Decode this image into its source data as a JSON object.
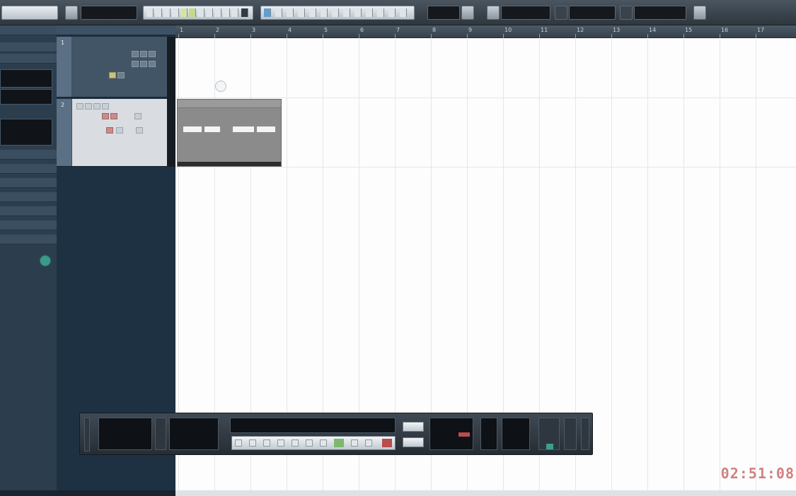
{
  "toolbar": {
    "buttons": [
      {
        "id": "project",
        "label": ""
      },
      {
        "id": "mode",
        "label": ""
      },
      {
        "id": "tools",
        "label": ""
      },
      {
        "id": "snap",
        "label": ""
      },
      {
        "id": "quantize",
        "label": ""
      },
      {
        "id": "grid",
        "label": ""
      },
      {
        "id": "colors",
        "label": ""
      }
    ]
  },
  "ruler": {
    "marks": [
      "1",
      "2",
      "3",
      "4",
      "5",
      "6",
      "7",
      "8",
      "9",
      "10",
      "11",
      "12",
      "13",
      "14",
      "15",
      "16",
      "17"
    ]
  },
  "tracks": [
    {
      "number": "1",
      "name": ""
    },
    {
      "number": "2",
      "name": ""
    }
  ],
  "time_display": "02:51:08",
  "colors": {
    "accent_green": "#6fa86a",
    "track_panel": "#1e3142",
    "time_display": "#d28080"
  }
}
